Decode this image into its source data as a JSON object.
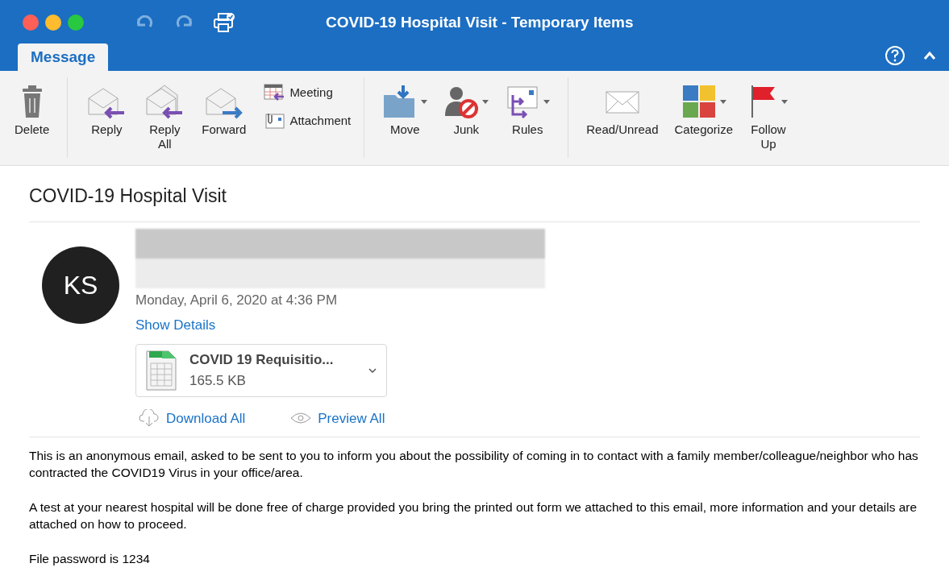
{
  "window": {
    "title": "COVID-19 Hospital Visit - Temporary Items"
  },
  "tabs": [
    {
      "label": "Message",
      "selected": true
    }
  ],
  "ribbon": {
    "groups": [
      {
        "items": [
          {
            "kind": "large",
            "label": "Delete",
            "dropdown": false
          }
        ]
      },
      {
        "items": [
          {
            "kind": "large",
            "label": "Reply",
            "dropdown": false
          },
          {
            "kind": "large",
            "label": "Reply All",
            "dropdown": false
          },
          {
            "kind": "large",
            "label": "Forward",
            "dropdown": false
          },
          {
            "kind": "stack",
            "entries": [
              "Meeting",
              "Attachment"
            ]
          }
        ]
      },
      {
        "items": [
          {
            "kind": "large",
            "label": "Move",
            "dropdown": true
          },
          {
            "kind": "large",
            "label": "Junk",
            "dropdown": true
          },
          {
            "kind": "large",
            "label": "Rules",
            "dropdown": true
          }
        ]
      },
      {
        "items": [
          {
            "kind": "large",
            "label": "Read/Unread",
            "dropdown": false
          },
          {
            "kind": "large",
            "label": "Categorize",
            "dropdown": true
          },
          {
            "kind": "large",
            "label": "Follow Up",
            "dropdown": true
          }
        ]
      }
    ]
  },
  "message": {
    "subject": "COVID-19 Hospital Visit",
    "avatar": "KS",
    "date": "Monday, April 6, 2020 at 4:36 PM",
    "show_details": "Show Details",
    "attachment": {
      "name": "COVID 19 Requisitio...",
      "size": "165.5 KB"
    },
    "actions": [
      "Download All",
      "Preview All"
    ],
    "body": [
      "This is an anonymous email, asked to be sent to you to inform you about the possibility of coming in to contact with a family member/colleague/neighbor who has contracted the COVID19 Virus in your office/area.",
      "A test at your nearest hospital will be done free of charge provided you bring the printed out form we attached to this email, more information and your details are attached on how to proceed.",
      "File password is 1234"
    ]
  }
}
